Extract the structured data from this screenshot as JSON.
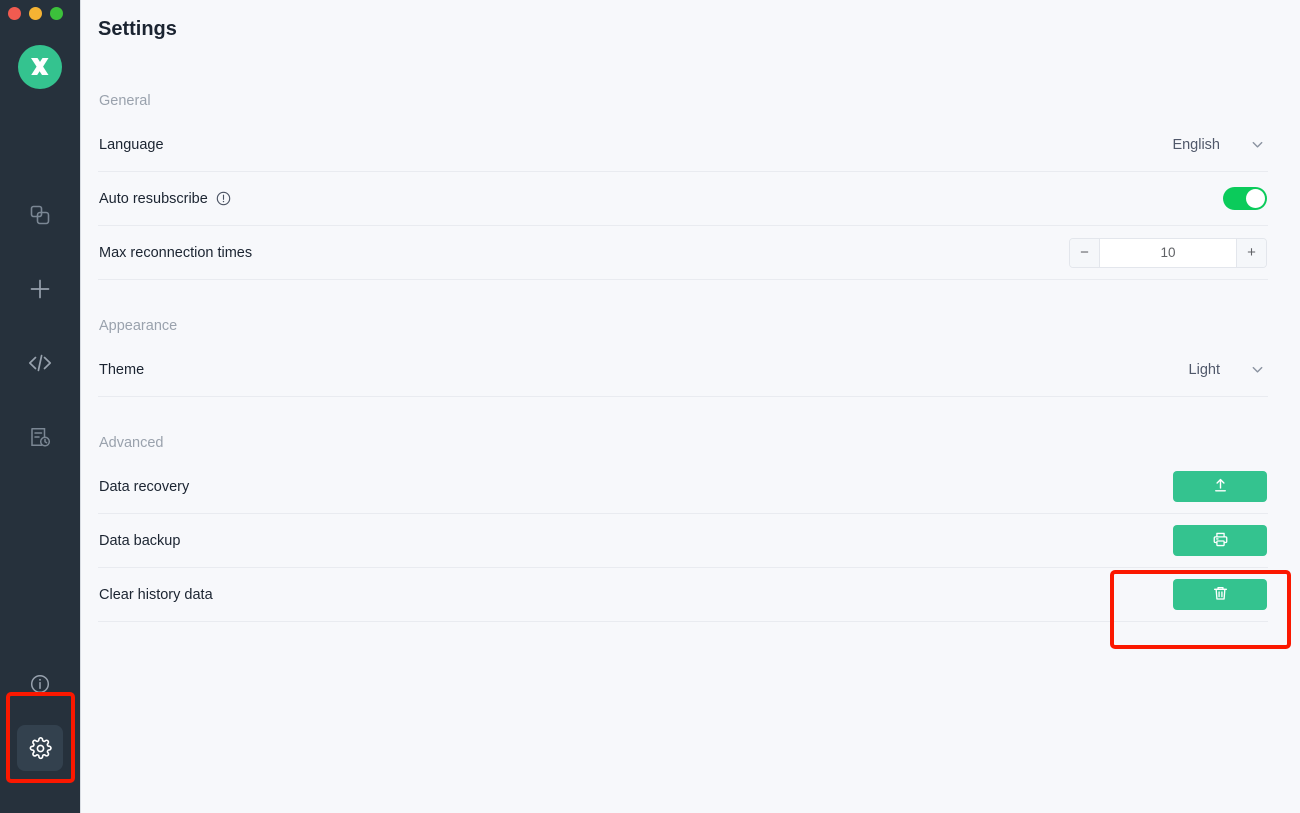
{
  "window": {
    "traffic_lights": [
      "close",
      "minimize",
      "maximize"
    ],
    "colors": {
      "close": "#f15b50",
      "minimize": "#f5b333",
      "maximize": "#3cc13b"
    }
  },
  "sidebar": {
    "logo_name": "mqttx-logo",
    "background": "#26313c",
    "top_items": [
      {
        "icon": "connections-icon",
        "name": "sidebar-item-connections"
      },
      {
        "icon": "plus-icon",
        "name": "sidebar-item-new-connection"
      },
      {
        "icon": "code-icon",
        "name": "sidebar-item-scripts"
      },
      {
        "icon": "log-history-icon",
        "name": "sidebar-item-log"
      }
    ],
    "bottom_items": [
      {
        "icon": "info-circle-icon",
        "name": "sidebar-item-about",
        "active": false
      },
      {
        "icon": "gear-icon",
        "name": "sidebar-item-settings",
        "active": true
      }
    ]
  },
  "header": {
    "title": "Settings"
  },
  "sections": [
    {
      "label": "General",
      "rows": [
        {
          "label": "Language",
          "control": "select",
          "value": "English"
        },
        {
          "label": "Auto resubscribe",
          "control": "toggle",
          "value": "on",
          "has_info_icon": true
        },
        {
          "label": "Max reconnection times",
          "control": "stepper",
          "value": "10",
          "minus": "−",
          "plus": "+"
        }
      ]
    },
    {
      "label": "Appearance",
      "rows": [
        {
          "label": "Theme",
          "control": "select",
          "value": "Light"
        }
      ]
    },
    {
      "label": "Advanced",
      "rows": [
        {
          "label": "Data recovery",
          "control": "button",
          "button_icon": "upload-icon"
        },
        {
          "label": "Data backup",
          "control": "button",
          "button_icon": "printer-icon"
        },
        {
          "label": "Clear history data",
          "control": "button",
          "button_icon": "trash-icon"
        }
      ]
    }
  ],
  "annotations": [
    {
      "name": "annotation-upload-button",
      "color": "#fb1800"
    },
    {
      "name": "annotation-settings-nav",
      "color": "#fb1800"
    }
  ],
  "theme_colors": {
    "accent_green": "#34c38f",
    "toggle_green": "#0bcb5b",
    "sidebar_dark": "#26313c",
    "content_bg": "#f7f8fb",
    "text_primary": "#1b2431",
    "text_muted": "#9aa2ad",
    "annotation_red": "#fb1800"
  }
}
